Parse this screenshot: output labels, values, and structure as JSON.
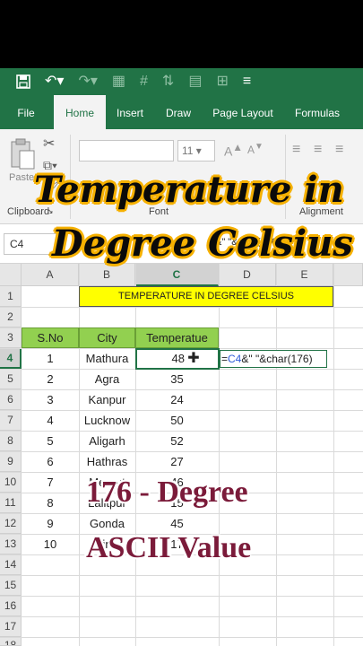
{
  "tabs": [
    "File",
    "Home",
    "Insert",
    "Draw",
    "Page Layout",
    "Formulas"
  ],
  "active_tab": "Home",
  "ribbon": {
    "paste_label": "Paste",
    "clipboard_label": "Clipboard",
    "font_label": "Font",
    "alignment_label": "Alignment",
    "font_size": "11"
  },
  "formula_bar": {
    "name_box": "C4",
    "formula_visible": "&\" \"&char(176)"
  },
  "columns": [
    "A",
    "B",
    "C",
    "D",
    "E"
  ],
  "rows": [
    "1",
    "2",
    "3",
    "4",
    "5",
    "6",
    "7",
    "8",
    "9",
    "10",
    "11",
    "12",
    "13",
    "14",
    "15",
    "16",
    "17",
    "18"
  ],
  "title_cell": "TEMPERATURE IN DEGREE CELSIUS",
  "table": {
    "headers": [
      "S.No",
      "City",
      "Temperatue"
    ],
    "rows": [
      [
        "1",
        "Mathura",
        "48"
      ],
      [
        "2",
        "Agra",
        "35"
      ],
      [
        "3",
        "Kanpur",
        "24"
      ],
      [
        "4",
        "Lucknow",
        "50"
      ],
      [
        "5",
        "Aligarh",
        "52"
      ],
      [
        "6",
        "Hathras",
        "27"
      ],
      [
        "7",
        "Meerut",
        "46"
      ],
      [
        "8",
        "Lalitpur",
        "15"
      ],
      [
        "9",
        "Gonda",
        "45"
      ],
      [
        "10",
        "Bijnor",
        "17"
      ]
    ]
  },
  "editing_cell": {
    "prefix": "=",
    "ref": "C4",
    "rest": "&\" \"&char(176)"
  },
  "overlay": {
    "line1": "Temperature in",
    "line2": "Degree Celsius",
    "line3": "176 - Degree",
    "line4": "ASCII Value"
  },
  "colors": {
    "excel_green": "#217346",
    "header_fill": "#92d050",
    "title_fill": "#ffff00"
  }
}
